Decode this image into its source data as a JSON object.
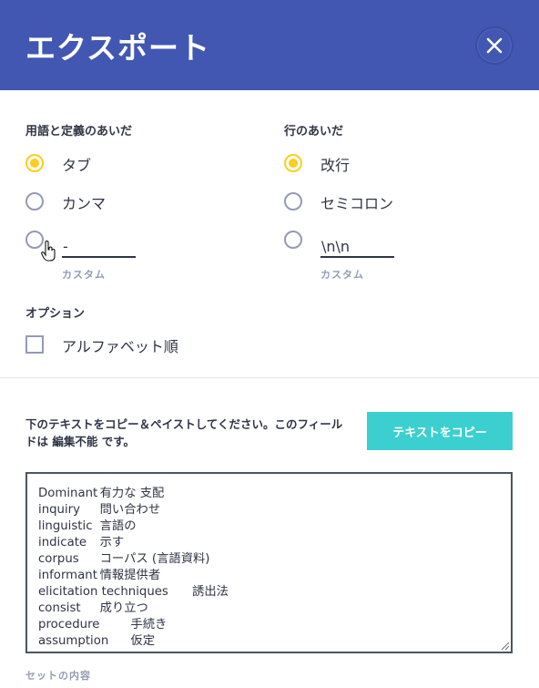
{
  "header": {
    "title": "エクスポート"
  },
  "term_separator": {
    "label": "用語と定義のあいだ",
    "options": [
      {
        "label": "タブ",
        "selected": true
      },
      {
        "label": "カンマ",
        "selected": false
      }
    ],
    "custom_value": "-",
    "custom_caption": "カスタム"
  },
  "row_separator": {
    "label": "行のあいだ",
    "options": [
      {
        "label": "改行",
        "selected": true
      },
      {
        "label": "セミコロン",
        "selected": false
      }
    ],
    "custom_value": "\\n\\n",
    "custom_caption": "カスタム"
  },
  "options": {
    "label": "オプション",
    "alphabetical_label": "アルファベット順",
    "alphabetical_checked": false
  },
  "export": {
    "instruction": "下のテキストをコピー＆ペイストしてください。このフィールドは 編集不能 です。",
    "copy_button": "テキストをコピー",
    "text": "Dominant\t有力な 支配\ninquiry\t問い合わせ\nlinguistic\t言語の\nindicate\t示す\ncorpus\tコーパス (言語資料)\ninformant\t情報提供者\nelicitation techniques\t誘出法\nconsist\t成り立つ\nprocedure\t手続き\nassumption\t仮定",
    "set_caption": "セットの内容"
  }
}
